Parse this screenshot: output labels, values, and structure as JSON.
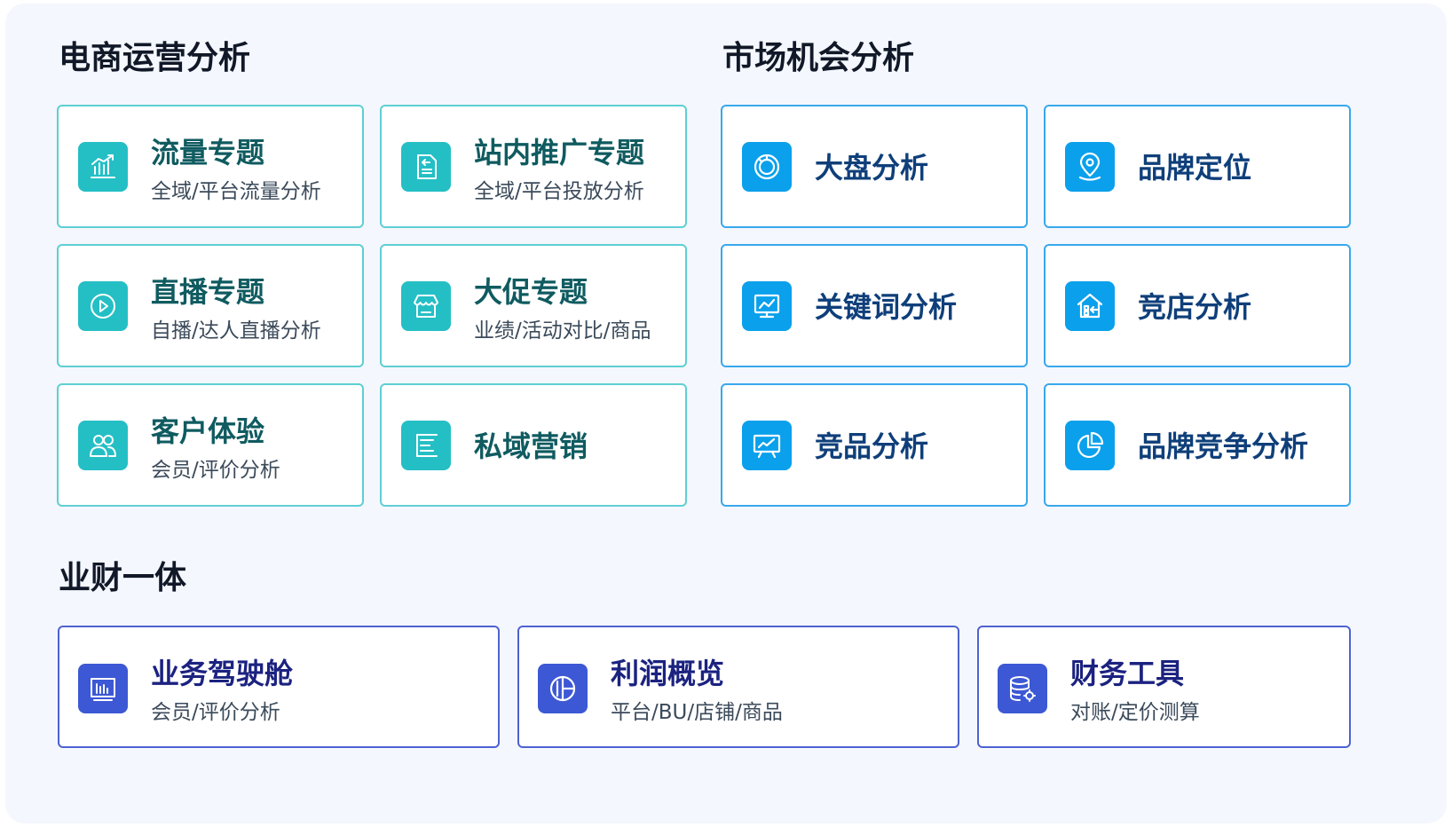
{
  "sections": {
    "ecommerce": {
      "title": "电商运营分析",
      "cards": [
        {
          "title": "流量专题",
          "subtitle": "全域/平台流量分析",
          "icon": "bar-chart-icon"
        },
        {
          "title": "站内推广专题",
          "subtitle": "全域/平台投放分析",
          "icon": "document-icon"
        },
        {
          "title": "直播专题",
          "subtitle": "自播/达人直播分析",
          "icon": "play-icon"
        },
        {
          "title": "大促专题",
          "subtitle": "业绩/活动对比/商品",
          "icon": "storefront-icon"
        },
        {
          "title": "客户体验",
          "subtitle": "会员/评价分析",
          "icon": "users-icon"
        },
        {
          "title": "私域营销",
          "subtitle": "",
          "icon": "list-icon"
        }
      ]
    },
    "market": {
      "title": "市场机会分析",
      "cards": [
        {
          "title": "大盘分析",
          "icon": "ring-chart-icon"
        },
        {
          "title": "品牌定位",
          "icon": "location-pin-icon"
        },
        {
          "title": "关键词分析",
          "icon": "monitor-chart-icon"
        },
        {
          "title": "竞店分析",
          "icon": "shop-house-icon"
        },
        {
          "title": "竞品分析",
          "icon": "presentation-board-icon"
        },
        {
          "title": "品牌竞争分析",
          "icon": "pie-chart-icon"
        }
      ]
    },
    "finance": {
      "title": "业财一体",
      "cards": [
        {
          "title": "业务驾驶舱",
          "subtitle": "会员/评价分析",
          "icon": "dashboard-icon"
        },
        {
          "title": "利润概览",
          "subtitle": "平台/BU/店铺/商品",
          "icon": "pie-segment-icon"
        },
        {
          "title": "财务工具",
          "subtitle": "对账/定价测算",
          "icon": "database-gear-icon"
        }
      ]
    }
  },
  "colors": {
    "panel_background": "#f4f7fd",
    "teal_accent": "#24bfc5",
    "blue_accent": "#0aa0ec",
    "navy_accent": "#3c58d4"
  }
}
